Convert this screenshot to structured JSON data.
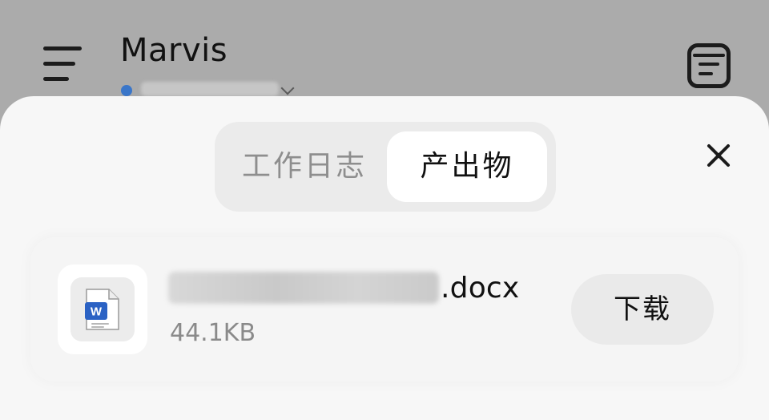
{
  "header": {
    "title": "Marvis",
    "menu_icon": "hamburger-menu-icon",
    "notes_icon": "notes-icon",
    "status_color": "#3a76c9"
  },
  "sheet": {
    "tabs": [
      {
        "label": "工作日志",
        "active": false
      },
      {
        "label": "产出物",
        "active": true
      }
    ],
    "close_icon": "close-icon"
  },
  "file": {
    "extension": ".docx",
    "size": "44.1KB",
    "icon": "word-document-icon",
    "icon_letter": "W",
    "icon_color": "#2b62c4",
    "download_label": "下载"
  }
}
